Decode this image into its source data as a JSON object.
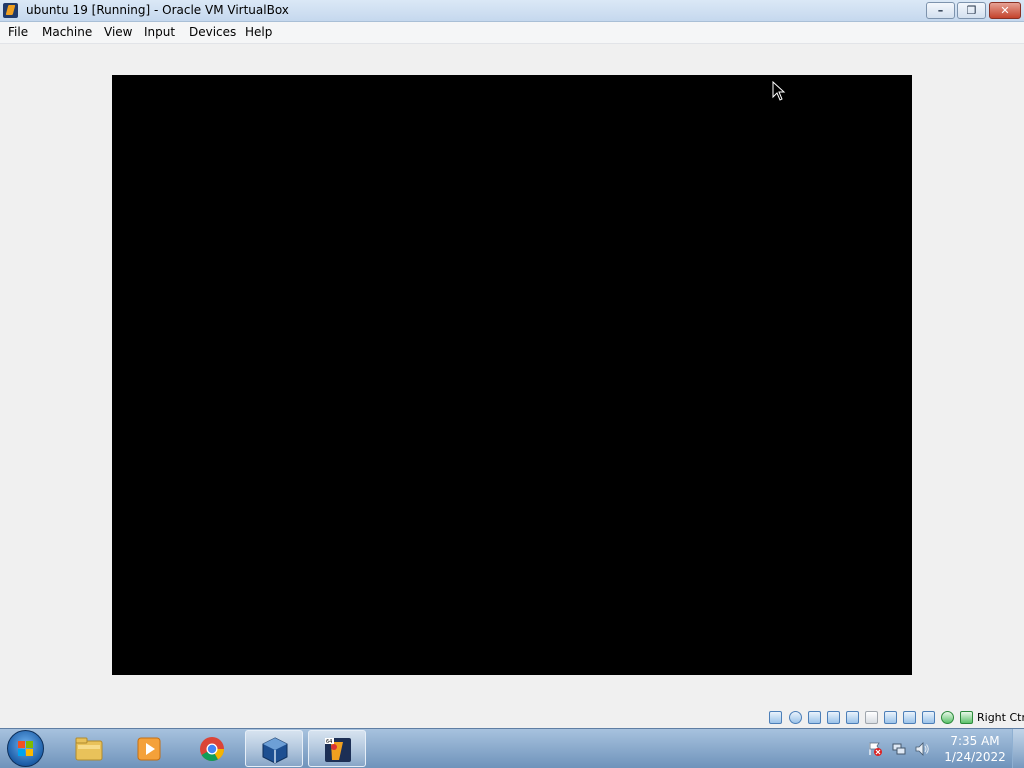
{
  "window": {
    "title": "ubuntu 19 [Running] - Oracle VM VirtualBox",
    "app_icon": "virtualbox-icon",
    "controls": {
      "minimize": "minimize-icon",
      "restore": "restore-icon",
      "close": "close-icon"
    }
  },
  "menu": {
    "items": [
      "File",
      "Machine",
      "View",
      "Input",
      "Devices",
      "Help"
    ]
  },
  "vm_display": {
    "background": "#000000",
    "cursor": "mouse-pointer-icon"
  },
  "statusbar": {
    "icons": [
      "hard-disk-icon",
      "optical-drive-icon",
      "audio-icon",
      "network-icon",
      "usb-icon",
      "shared-folders-icon",
      "display-icon",
      "screen-capture-icon",
      "virtualization-icon",
      "processing-icon",
      "mouse-integration-icon",
      "keyboard-icon"
    ],
    "host_key": "Right Ctrl"
  },
  "taskbar": {
    "start": "windows-start-icon",
    "pinned": [
      "file-explorer-icon",
      "media-player-icon",
      "chrome-icon",
      "virtualbox-icon",
      "virtualbox-vm-icon"
    ],
    "tray_icons": [
      "action-center-icon",
      "network-icon",
      "volume-icon"
    ],
    "clock": {
      "time": "7:35 AM",
      "date": "1/24/2022"
    }
  },
  "colors": {
    "accent": "#3f6fa8",
    "vm_screen": "#000000",
    "taskbar": "#8aa9cc"
  }
}
